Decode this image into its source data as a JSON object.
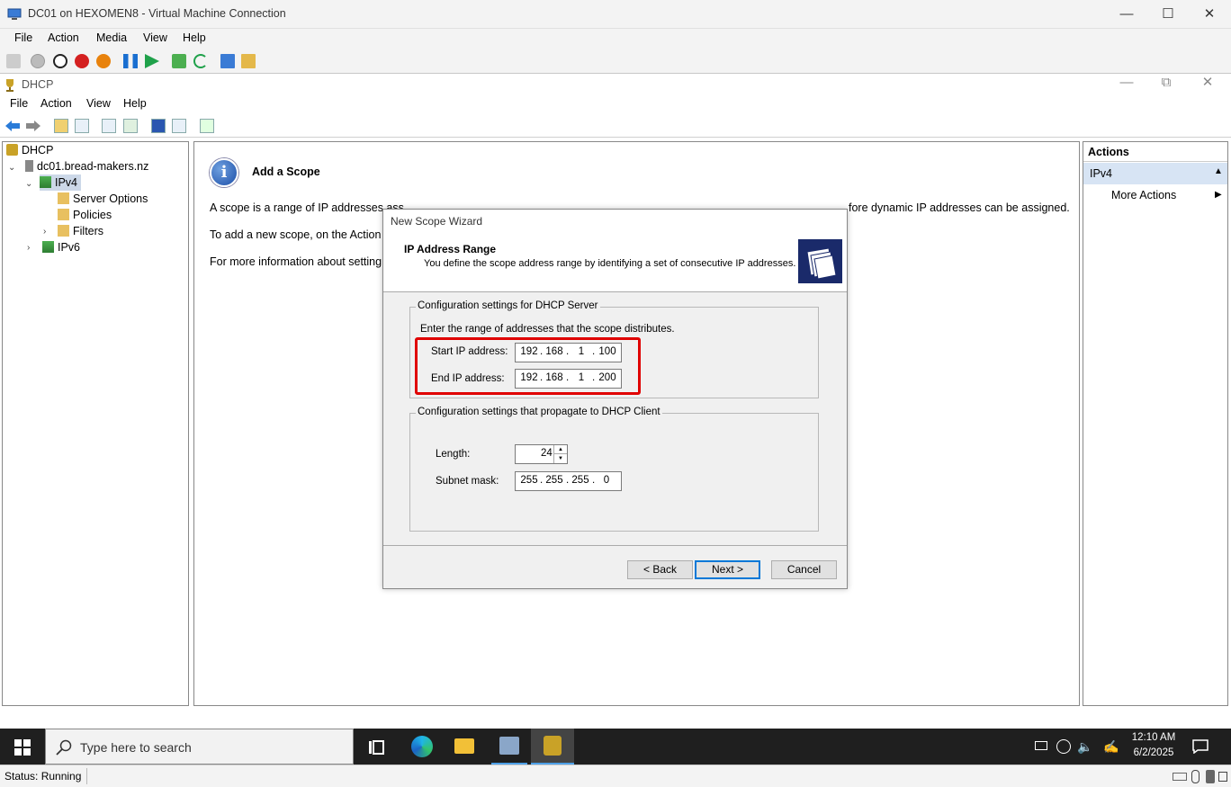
{
  "vm_window": {
    "title": "DC01 on HEXOMEN8 - Virtual Machine Connection",
    "menu": [
      "File",
      "Action",
      "Media",
      "View",
      "Help"
    ]
  },
  "mmc": {
    "title": "DHCP",
    "menu": [
      "File",
      "Action",
      "View",
      "Help"
    ]
  },
  "tree": {
    "root": "DHCP",
    "server": "dc01.bread-makers.nz",
    "ipv4": "IPv4",
    "server_options": "Server Options",
    "policies": "Policies",
    "filters": "Filters",
    "ipv6": "IPv6"
  },
  "center": {
    "heading": "Add a Scope",
    "para1_left": "A scope is a range of IP addresses ass",
    "para1_right": "fore dynamic IP addresses can be assigned.",
    "para2": "To add a new scope, on the Action m",
    "para3": "For more information about setting u"
  },
  "actions": {
    "header": "Actions",
    "section": "IPv4",
    "more": "More Actions"
  },
  "dialog": {
    "title": "New Scope Wizard",
    "header_title": "IP Address Range",
    "header_subtitle": "You define the scope address range by identifying a set of consecutive IP addresses.",
    "group1_label": "Configuration settings for DHCP Server",
    "group1_desc": "Enter the range of addresses that the scope distributes.",
    "start_label": "Start IP address:",
    "start_ip": [
      "192",
      "168",
      "1",
      "100"
    ],
    "end_label": "End IP address:",
    "end_ip": [
      "192",
      "168",
      "1",
      "200"
    ],
    "group2_label": "Configuration settings that propagate to DHCP Client",
    "length_label": "Length:",
    "length_value": "24",
    "mask_label": "Subnet mask:",
    "mask": [
      "255",
      "255",
      "255",
      "0"
    ],
    "back": "< Back",
    "next": "Next >",
    "cancel": "Cancel",
    "highlight_color": "#e00000"
  },
  "taskbar": {
    "search_placeholder": "Type here to search",
    "time": "12:10 AM",
    "date": "6/2/2025"
  },
  "status": {
    "text": "Status: Running"
  }
}
